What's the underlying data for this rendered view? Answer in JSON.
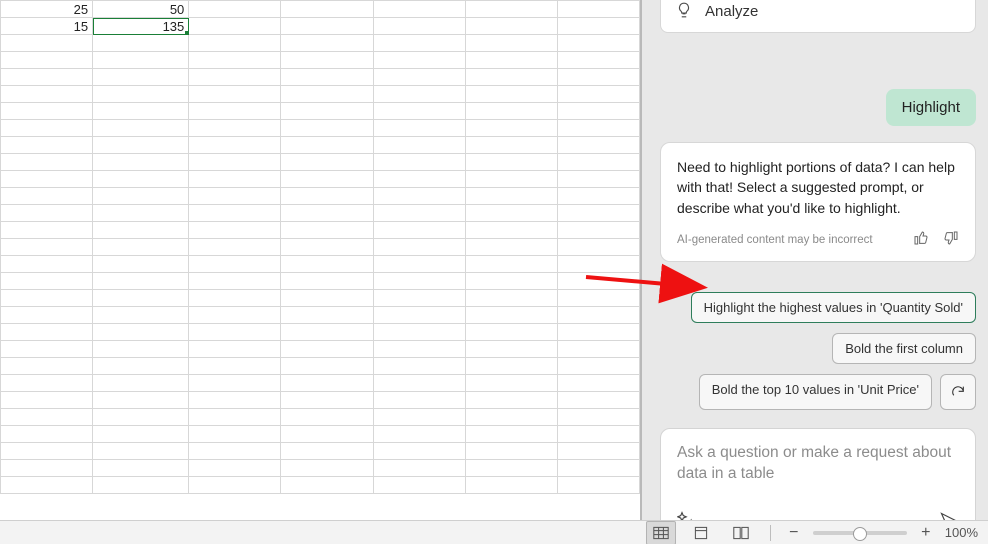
{
  "sheet": {
    "cells": [
      [
        "25",
        "50",
        "",
        "",
        "",
        "",
        ""
      ],
      [
        "15",
        "135",
        "",
        "",
        "",
        "",
        ""
      ]
    ],
    "selected": {
      "row": 1,
      "col": 1
    },
    "blank_rows": 27
  },
  "copilot": {
    "analyze_label": "Analyze",
    "user_message": "Highlight",
    "ai_message": "Need to highlight portions of data? I can help with that! Select a suggested prompt, or describe what you'd like to highlight.",
    "disclaimer": "AI-generated content may be incorrect",
    "suggestions": {
      "s1": "Highlight the highest values in 'Quantity Sold'",
      "s2": "Bold the first column",
      "s3": "Bold the top 10 values in 'Unit Price'"
    },
    "input_placeholder": "Ask a question or make a request about data in a table"
  },
  "status": {
    "zoom_label": "100%"
  }
}
